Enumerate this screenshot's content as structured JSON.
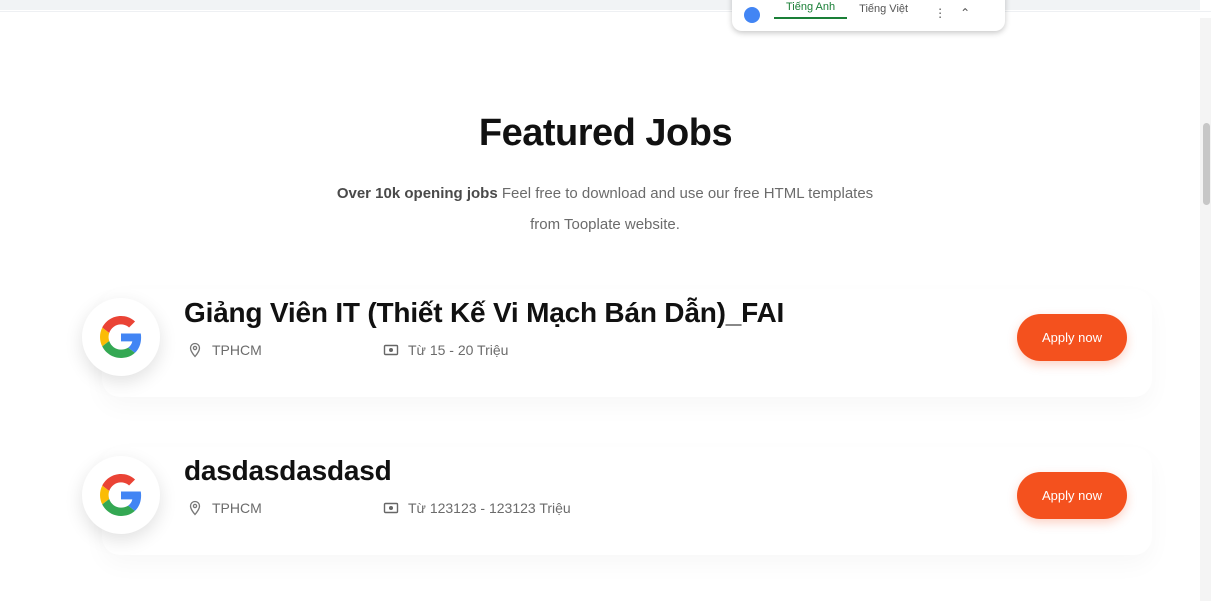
{
  "translate_bar": {
    "tabs": [
      "Tiếng Anh",
      "Tiếng Việt"
    ],
    "active_tab_index": 0,
    "menu_glyph": "⋮",
    "close_glyph": "⌃"
  },
  "section": {
    "title": "Featured Jobs",
    "subtitle_bold": "Over 10k opening jobs",
    "subtitle_rest": " Feel free to download and use our free HTML templates from Tooplate website."
  },
  "jobs": [
    {
      "title": "Giảng Viên IT (Thiết Kế Vi Mạch Bán Dẫn)_FAI",
      "location": "TPHCM",
      "salary": "Từ 15 - 20 Triệu",
      "apply_label": "Apply now",
      "logo_icon": "google-logo-icon"
    },
    {
      "title": "dasdasdasdasd",
      "location": "TPHCM",
      "salary": "Từ 123123 - 123123 Triệu",
      "apply_label": "Apply now",
      "logo_icon": "google-logo-icon"
    }
  ],
  "colors": {
    "accent": "#f4511e",
    "translate_active": "#1a7f37"
  }
}
